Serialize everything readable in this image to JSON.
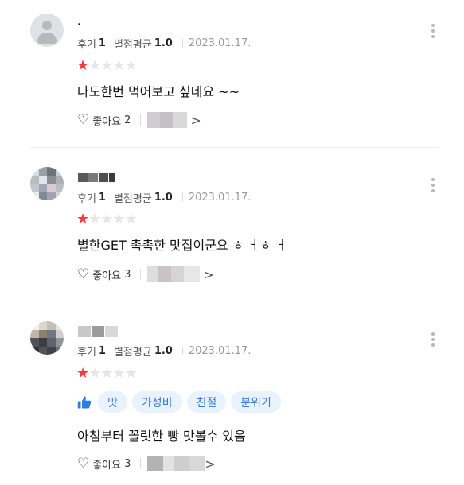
{
  "reviews": [
    {
      "nickname": ".",
      "review_count_label": "후기",
      "review_count": "1",
      "rating_avg_label": "별점평균",
      "rating_avg": "1.0",
      "date": "2023.01.17.",
      "stars": 1,
      "tags": [],
      "text": "나도한번 먹어보고 싶네요 ~~",
      "like_label": "좋아요",
      "like_count": "2"
    },
    {
      "nickname": "",
      "review_count_label": "후기",
      "review_count": "1",
      "rating_avg_label": "별점평균",
      "rating_avg": "1.0",
      "date": "2023.01.17.",
      "stars": 1,
      "tags": [],
      "text": "별한GET 촉촉한 맛집이군요 ㅎ ㅓㅎ ㅓ",
      "like_label": "좋아요",
      "like_count": "3"
    },
    {
      "nickname": "",
      "review_count_label": "후기",
      "review_count": "1",
      "rating_avg_label": "별점평균",
      "rating_avg": "1.0",
      "date": "2023.01.17.",
      "stars": 1,
      "tags": [
        "맛",
        "가성비",
        "친절",
        "분위기"
      ],
      "text": "아침부터 꼴릿한 빵 맛볼수 있음",
      "like_label": "좋아요",
      "like_count": "3"
    }
  ],
  "icons": {
    "heart": "heart-outline-icon",
    "more": "kebab-menu-icon",
    "thumb": "thumbs-up-icon",
    "star": "star-icon",
    "chevron": "chevron-right-icon"
  },
  "colors": {
    "star_on": "#f03e3e",
    "star_off": "#e6e6e6",
    "tag_bg": "#e8f3ff",
    "tag_text": "#3d7bd9",
    "thumb": "#2f7de1"
  }
}
